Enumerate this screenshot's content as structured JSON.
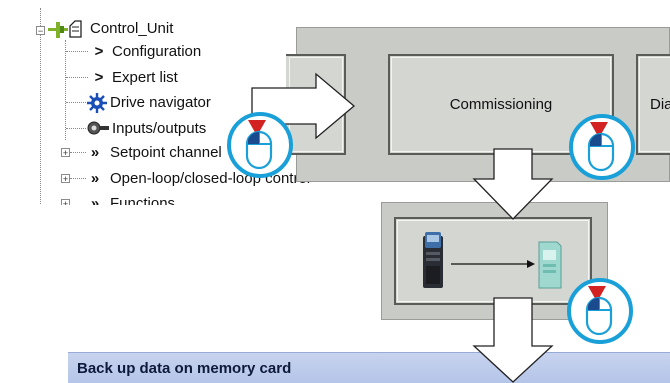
{
  "tree": {
    "items": [
      {
        "label": "Control_Unit"
      },
      {
        "label": "Configuration"
      },
      {
        "label": "Expert list"
      },
      {
        "label": "Drive navigator"
      },
      {
        "label": "Inputs/outputs"
      },
      {
        "label": "Setpoint channel"
      },
      {
        "label": "Open-loop/closed-loop control"
      },
      {
        "label": "Functions"
      }
    ]
  },
  "toolbar": {
    "commissioning_label": "Commissioning",
    "diagnostics_label": "Dia"
  },
  "backup_panel": {
    "image": "inverter-to-memory-card"
  },
  "dialog": {
    "title": "Back up data on memory card"
  },
  "icons": {
    "mouse": "mouse-left-click-icon",
    "arrow": "flow-arrow"
  },
  "colors": {
    "panel_gray": "#c9cbc7",
    "mouse_ring": "#1aa0d8",
    "click_red": "#d32222",
    "titlebar_blue": "#b5c5e9"
  }
}
